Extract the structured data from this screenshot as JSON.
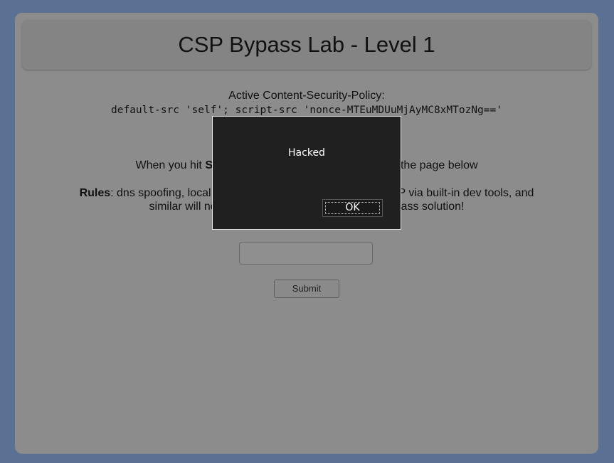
{
  "page": {
    "title": "CSP Bypass Lab - Level 1"
  },
  "csp": {
    "label": "Active Content-Security-Policy:",
    "value": "default-src 'self'; script-src 'nonce-MTEuMDUuMjAyMC8xMTozNg=='"
  },
  "instructions": {
    "prefix": "When you hit ",
    "bold_visible": "S",
    "suffix": "the page below"
  },
  "rules": {
    "label": "Rules",
    "line1_left": ": dns spoofing, local dns",
    "line1_right": " CSP via built-in dev tools, and",
    "line2_left": "similar will no",
    "line2_right": "pass solution!"
  },
  "form": {
    "input_value": "",
    "submit_label": "Submit"
  },
  "dialog": {
    "message": "Hacked",
    "ok_label": "OK"
  },
  "colors": {
    "background": "#5b7194",
    "card": "#8c8c8c",
    "dialog_bg": "#202020"
  }
}
